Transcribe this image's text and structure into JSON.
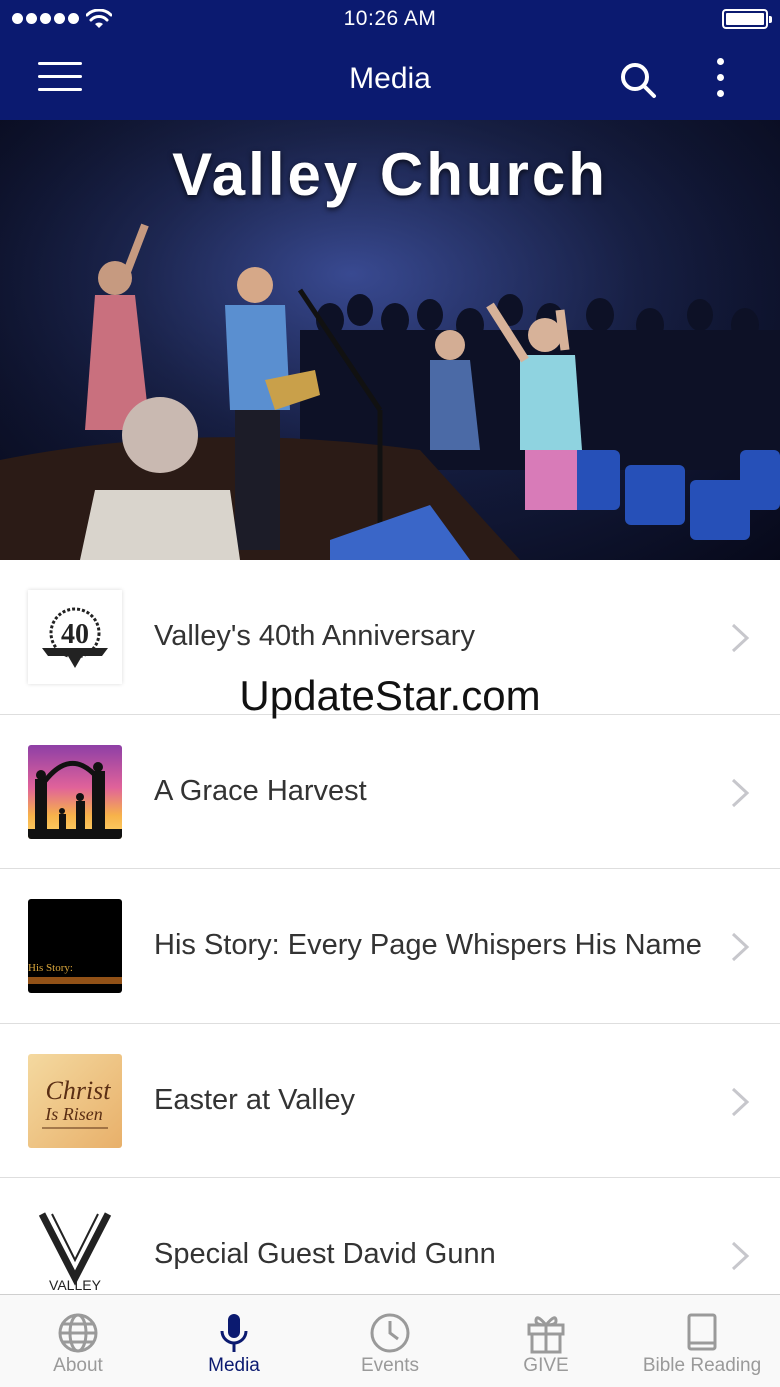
{
  "status_bar": {
    "time": "10:26 AM"
  },
  "header": {
    "title": "Media"
  },
  "hero": {
    "title": "Valley Church"
  },
  "media_list": [
    {
      "title": "Valley's 40th Anniversary",
      "thumb": "anniversary-40-logo"
    },
    {
      "title": "A Grace Harvest",
      "thumb": "family-silhouette-sunset"
    },
    {
      "title": "His Story: Every Page Whispers His Name",
      "thumb": "his-story-series"
    },
    {
      "title": "Easter at Valley",
      "thumb": "christ-is-risen"
    },
    {
      "title": "Special Guest David Gunn",
      "thumb": "valley-church-logo"
    }
  ],
  "thumb_text": {
    "anniversary": "40",
    "his_story": "His Story:",
    "christ": "Christ",
    "is_risen": "Is Risen",
    "valley": "VALLEY"
  },
  "watermark": "UpdateStar.com",
  "tabs": [
    {
      "label": "About",
      "icon": "globe-icon",
      "active": false
    },
    {
      "label": "Media",
      "icon": "microphone-icon",
      "active": true
    },
    {
      "label": "Events",
      "icon": "clock-icon",
      "active": false
    },
    {
      "label": "GIVE",
      "icon": "gift-icon",
      "active": false
    },
    {
      "label": "Bible Reading",
      "icon": "book-icon",
      "active": false
    }
  ],
  "colors": {
    "nav_bg": "#0b1a70",
    "active_tab": "#0b1a70",
    "inactive_tab": "#9a9a9a"
  }
}
